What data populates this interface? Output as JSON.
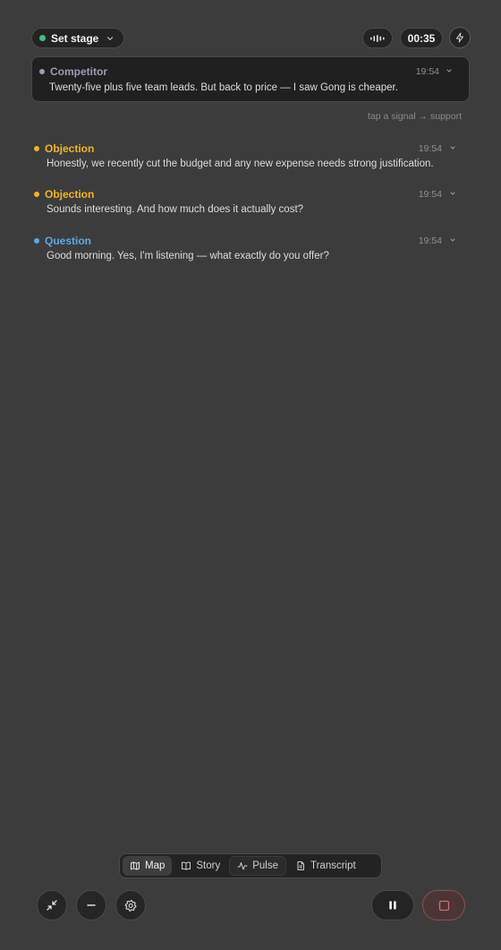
{
  "header": {
    "stage_label": "Set stage",
    "timer": "00:35",
    "stage_status_color": "#3ec27a"
  },
  "featured": {
    "type": "Competitor",
    "time": "19:54",
    "text": "Twenty-five plus five team leads. But back to price — I saw Gong is cheaper.",
    "color": "#9a9ab6"
  },
  "hint": "tap a signal → support",
  "signals": [
    {
      "type": "Objection",
      "time": "19:54",
      "text": "Honestly, we recently cut the budget and any new expense needs strong justification.",
      "color": "#f0b429"
    },
    {
      "type": "Objection",
      "time": "19:54",
      "text": "Sounds interesting. And how much does it actually cost?",
      "color": "#f0b429"
    },
    {
      "type": "Question",
      "time": "19:54",
      "text": "Good morning. Yes, I'm listening — what exactly do you offer?",
      "color": "#5aa9e6"
    }
  ],
  "tabs": [
    {
      "label": "Map",
      "icon": "map-icon",
      "active": true
    },
    {
      "label": "Story",
      "icon": "book-icon",
      "active": false
    },
    {
      "label": "Pulse",
      "icon": "pulse-icon",
      "active": false
    },
    {
      "label": "Transcript",
      "icon": "document-icon",
      "active": false
    }
  ],
  "controls": {
    "icons": [
      "collapse-icon",
      "minus-icon",
      "gear-icon",
      "pause-icon",
      "stop-icon"
    ],
    "stop_color": "#c46a6a"
  }
}
